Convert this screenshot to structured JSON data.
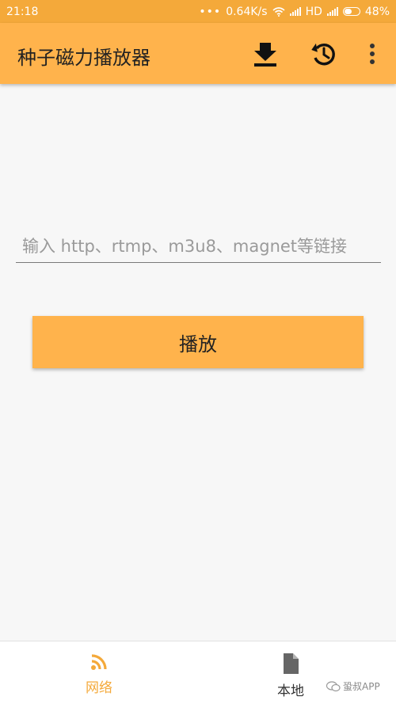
{
  "status_bar": {
    "time": "21:18",
    "dots": "•••",
    "net_speed": "0.64K/s",
    "network_type": "HD",
    "battery": "48%",
    "icons": [
      "wifi-icon",
      "signal-icon",
      "battery-icon"
    ]
  },
  "app_bar": {
    "title": "种子磁力播放器",
    "icons": [
      "download-icon",
      "history-icon",
      "more-vert-icon"
    ]
  },
  "url_input": {
    "placeholder": "输入 http、rtmp、m3u8、magnet等链接",
    "value": ""
  },
  "play_button": {
    "label": "播放"
  },
  "bottom_nav": {
    "tabs": [
      {
        "label": "网络",
        "icon": "rss-feed-icon",
        "active": true
      },
      {
        "label": "本地",
        "icon": "file-icon",
        "active": false
      }
    ]
  },
  "watermark": {
    "text": "蛩叔APP"
  },
  "colors": {
    "status_bar": "#f4a93a",
    "app_bar": "#ffb34c",
    "button": "#ffb34c",
    "active_tab": "#f4a93a",
    "background": "#f7f7f7"
  }
}
